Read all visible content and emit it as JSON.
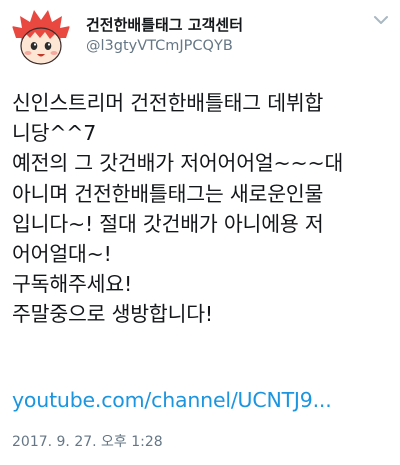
{
  "user": {
    "display_name": "건전한배틀태그 고객센터",
    "handle": "@l3gtyVTCmJPCQYB",
    "avatar_icon": "cartoon-face-avatar"
  },
  "tweet": {
    "lines": [
      "신인스트리머 건전한배틀태그 데뷔합",
      "니당^^7",
      "예전의 그 갓건배가 저어어어얼~~~대",
      "아니며 건전한배틀태그는 새로운인물",
      "입니다~! 절대 갓건배가 아니에용 저",
      "어어얼대~!",
      "구독해주세요!",
      "주말중으로 생방합니다!"
    ],
    "link": "youtube.com/channel/UCNTJ9...",
    "timestamp": "2017. 9. 27. 오후 1:28"
  },
  "colors": {
    "link": "#1b95e0",
    "secondary_text": "#657786",
    "avatar_hair": "#e8483f"
  }
}
